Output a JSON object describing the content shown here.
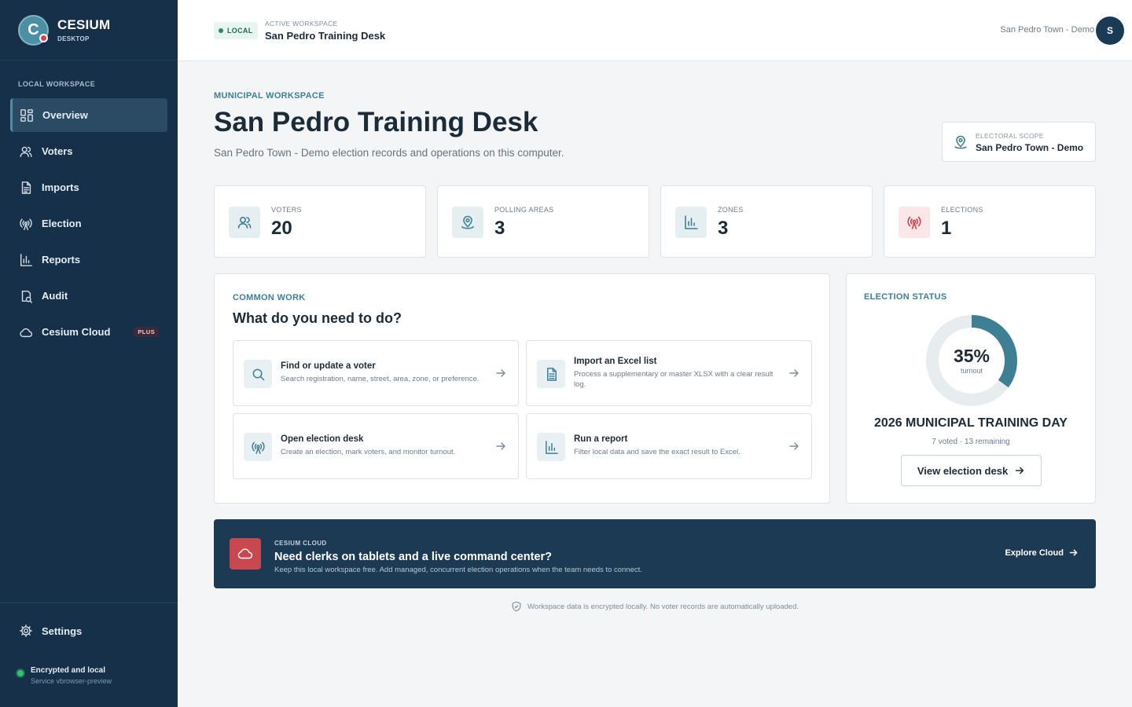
{
  "sidebar": {
    "brand_name": "CESIUM",
    "brand_sub": "DESKTOP",
    "logo_letter": "C",
    "section_label": "LOCAL WORKSPACE",
    "items": [
      {
        "label": "Overview",
        "icon": "grid-icon",
        "active": true
      },
      {
        "label": "Voters",
        "icon": "users-icon"
      },
      {
        "label": "Imports",
        "icon": "file-icon"
      },
      {
        "label": "Election",
        "icon": "broadcast-icon"
      },
      {
        "label": "Reports",
        "icon": "bar-chart-icon"
      },
      {
        "label": "Audit",
        "icon": "audit-icon"
      },
      {
        "label": "Cesium Cloud",
        "icon": "cloud-icon",
        "badge": "PLUS"
      }
    ],
    "settings_label": "Settings",
    "status_title": "Encrypted and local",
    "status_sub": "Service vbrowser-preview"
  },
  "topbar": {
    "badge": "LOCAL",
    "workspace_label": "ACTIVE WORKSPACE",
    "workspace_name": "San Pedro Training Desk",
    "user_text": "San Pedro Town - Demo",
    "avatar_letter": "S"
  },
  "header": {
    "eyebrow": "MUNICIPAL WORKSPACE",
    "title": "San Pedro Training Desk",
    "subtitle": "San Pedro Town - Demo election records and operations on this computer.",
    "scope_label": "ELECTORAL SCOPE",
    "scope_value": "San Pedro Town - Demo"
  },
  "stats": [
    {
      "label": "VOTERS",
      "value": "20",
      "icon": "users-icon"
    },
    {
      "label": "POLLING AREAS",
      "value": "3",
      "icon": "map-pin-icon"
    },
    {
      "label": "ZONES",
      "value": "3",
      "icon": "bar-chart-icon"
    },
    {
      "label": "ELECTIONS",
      "value": "1",
      "icon": "broadcast-icon"
    }
  ],
  "common_work": {
    "eyebrow": "COMMON WORK",
    "title": "What do you need to do?",
    "tasks": [
      {
        "title": "Find or update a voter",
        "desc": "Search registration, name, street, area, zone, or preference.",
        "icon": "search-icon"
      },
      {
        "title": "Import an Excel list",
        "desc": "Process a supplementary or master XLSX with a clear result log.",
        "icon": "spreadsheet-icon"
      },
      {
        "title": "Open election desk",
        "desc": "Create an election, mark voters, and monitor turnout.",
        "icon": "broadcast-icon"
      },
      {
        "title": "Run a report",
        "desc": "Filter local data and save the exact result to Excel.",
        "icon": "bar-chart-icon"
      }
    ]
  },
  "election_status": {
    "eyebrow": "ELECTION STATUS",
    "turnout_pct": "35%",
    "turnout_fraction": 0.35,
    "turnout_caption": "turnout",
    "name": "2026 MUNICIPAL TRAINING DAY",
    "meta": "7 voted · 13 remaining",
    "button_label": "View election desk"
  },
  "cloud_banner": {
    "eyebrow": "CESIUM CLOUD",
    "title": "Need clerks on tablets and a live command center?",
    "subtitle": "Keep this local workspace free. Add managed, concurrent election operations when the team needs to connect.",
    "link_label": "Explore Cloud"
  },
  "footer_note": "Workspace data is encrypted locally. No voter records are automatically uploaded.",
  "colors": {
    "sidebar_bg": "#163049",
    "accent": "#3f7f93",
    "alert": "#c9474f",
    "banner_bg": "#1c3a53"
  }
}
